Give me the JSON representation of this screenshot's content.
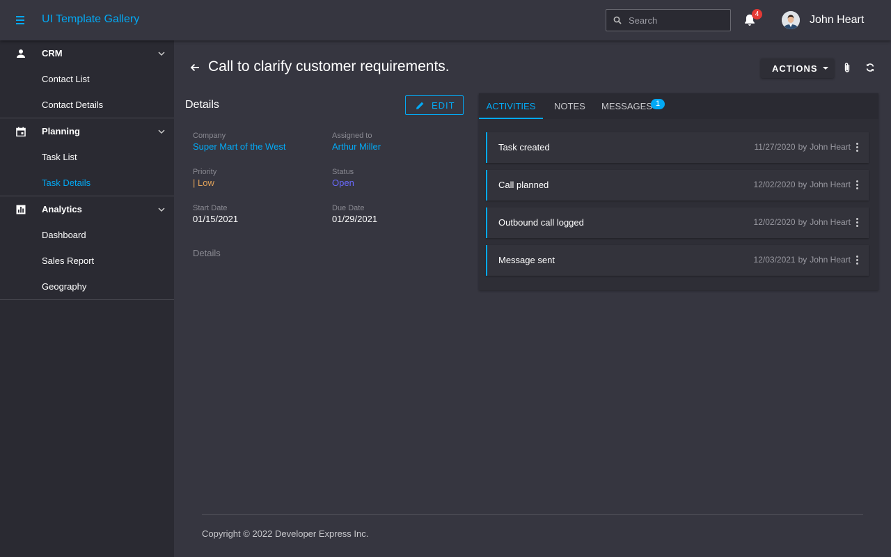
{
  "header": {
    "app_title": "UI Template Gallery",
    "search_placeholder": "Search",
    "notifications_count": "4",
    "user_name": "John Heart"
  },
  "sidebar": {
    "groups": [
      {
        "label": "CRM",
        "icon": "person-icon",
        "items": [
          {
            "label": "Contact List"
          },
          {
            "label": "Contact Details"
          }
        ]
      },
      {
        "label": "Planning",
        "icon": "calendar-icon",
        "items": [
          {
            "label": "Task List"
          },
          {
            "label": "Task Details",
            "active": true
          }
        ]
      },
      {
        "label": "Analytics",
        "icon": "chart-icon",
        "items": [
          {
            "label": "Dashboard"
          },
          {
            "label": "Sales Report"
          },
          {
            "label": "Geography"
          }
        ]
      }
    ]
  },
  "page": {
    "title": "Call to clarify customer requirements.",
    "actions_label": "ACTIONS"
  },
  "details": {
    "heading": "Details",
    "edit_label": "EDIT",
    "company_label": "Company",
    "company_value": "Super Mart of the West",
    "assigned_label": "Assigned to",
    "assigned_value": "Arthur Miller",
    "priority_label": "Priority",
    "priority_value": "| Low",
    "status_label": "Status",
    "status_value": "Open",
    "start_label": "Start Date",
    "start_value": "01/15/2021",
    "due_label": "Due Date",
    "due_value": "01/29/2021",
    "sub_heading": "Details"
  },
  "tabs": {
    "activities": "ACTIVITIES",
    "notes": "NOTES",
    "messages": "MESSAGES",
    "messages_badge": "1"
  },
  "activities": [
    {
      "name": "Task created",
      "date": "11/27/2020",
      "by": "by",
      "author": "John Heart"
    },
    {
      "name": "Call planned",
      "date": "12/02/2020",
      "by": "by",
      "author": "John Heart"
    },
    {
      "name": "Outbound call logged",
      "date": "12/02/2020",
      "by": "by",
      "author": "John Heart"
    },
    {
      "name": "Message sent",
      "date": "12/03/2021",
      "by": "by",
      "author": "John Heart"
    }
  ],
  "footer": {
    "copyright": "Copyright © 2022 Developer Express Inc."
  },
  "colors": {
    "accent": "#03a9f4",
    "background": "#363640",
    "sidebar": "#2a2a32",
    "priority_low": "#e0a25a",
    "status_open": "#6a6aff",
    "badge_red": "#e53935"
  }
}
